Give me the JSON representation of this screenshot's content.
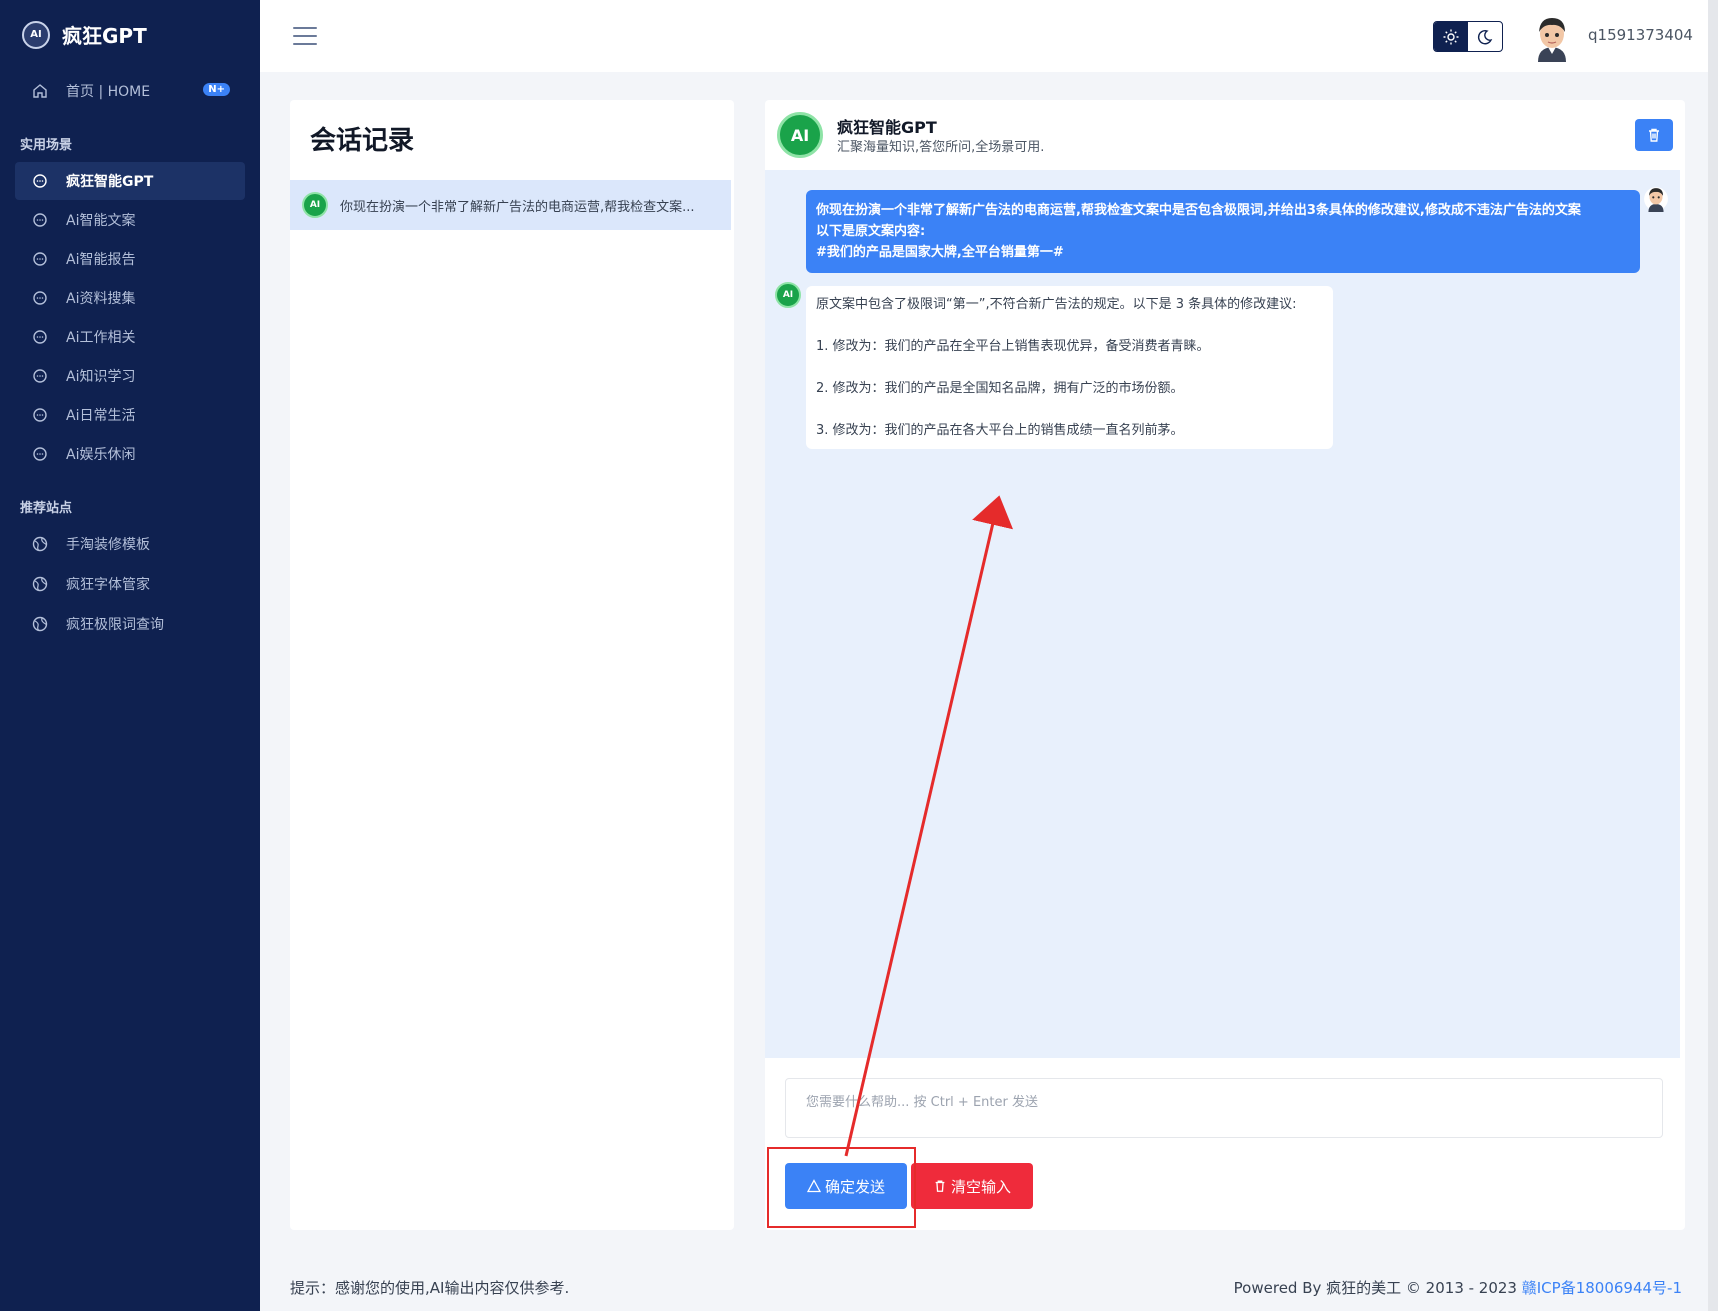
{
  "brand": {
    "name": "疯狂GPT",
    "logo_text": "AI"
  },
  "sidebar": {
    "home": {
      "label": "首页 | HOME",
      "badge": "N+"
    },
    "section_scenes": "实用场景",
    "scenes": [
      {
        "label": "疯狂智能GPT",
        "active": true
      },
      {
        "label": "Ai智能文案"
      },
      {
        "label": "Ai智能报告"
      },
      {
        "label": "Ai资料搜集"
      },
      {
        "label": "Ai工作相关"
      },
      {
        "label": "Ai知识学习"
      },
      {
        "label": "Ai日常生活"
      },
      {
        "label": "Ai娱乐休闲"
      }
    ],
    "section_sites": "推荐站点",
    "sites": [
      {
        "label": "手淘装修模板"
      },
      {
        "label": "疯狂字体管家"
      },
      {
        "label": "疯狂极限词查询"
      }
    ]
  },
  "topbar": {
    "username": "q1591373404"
  },
  "history": {
    "title": "会话记录",
    "items": [
      {
        "text": "你现在扮演一个非常了解新广告法的电商运营,帮我检查文案..."
      }
    ]
  },
  "chat": {
    "title": "疯狂智能GPT",
    "subtitle": "汇聚海量知识,答您所问,全场景可用.",
    "user_message": [
      "你现在扮演一个非常了解新广告法的电商运营,帮我检查文案中是否包含极限词,并给出3条具体的修改建议,修改成不违法广告法的文案",
      "以下是原文案内容:",
      "#我们的产品是国家大牌,全平台销量第一#"
    ],
    "ai_message": [
      "原文案中包含了极限词“第一”,不符合新广告法的规定。以下是 3 条具体的修改建议:",
      "1. 修改为：我们的产品在全平台上销售表现优异，备受消费者青睐。",
      "2. 修改为：我们的产品是全国知名品牌，拥有广泛的市场份额。",
      "3. 修改为：我们的产品在各大平台上的销售成绩一直名列前茅。"
    ],
    "input_placeholder": "您需要什么帮助... 按 Ctrl + Enter 发送",
    "send_label": "确定发送",
    "clear_label": "清空输入"
  },
  "footer": {
    "note": "提示：感谢您的使用,AI输出内容仅供参考.",
    "powered": "Powered By 疯狂的美工 © 2013 - 2023 ",
    "icp": "赣ICP备18006944号-1"
  },
  "colors": {
    "sidebar_bg": "#0f2150",
    "accent": "#3b82f6",
    "danger": "#ef2b3b",
    "chat_bg": "#e8f0fc",
    "annotation": "#e52b2b"
  }
}
